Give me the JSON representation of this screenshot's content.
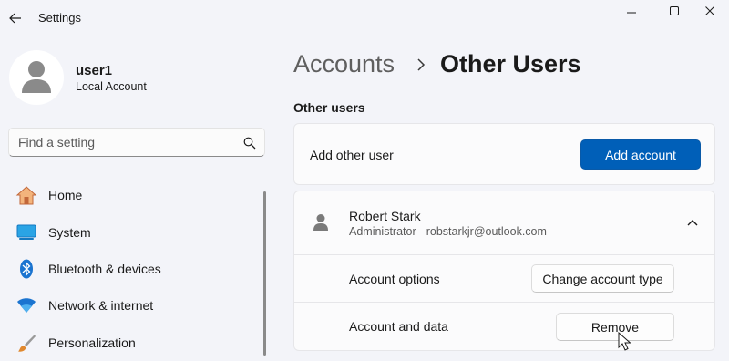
{
  "window": {
    "title": "Settings"
  },
  "user": {
    "name": "user1",
    "type": "Local Account"
  },
  "search": {
    "placeholder": "Find a setting"
  },
  "sidebar": {
    "items": [
      {
        "label": "Home",
        "icon": "home-icon"
      },
      {
        "label": "System",
        "icon": "system-icon"
      },
      {
        "label": "Bluetooth & devices",
        "icon": "bluetooth-icon"
      },
      {
        "label": "Network & internet",
        "icon": "wifi-icon"
      },
      {
        "label": "Personalization",
        "icon": "brush-icon"
      }
    ]
  },
  "breadcrumb": {
    "parent": "Accounts",
    "current": "Other Users"
  },
  "main": {
    "section_title": "Other users",
    "add_user_label": "Add other user",
    "add_account_button": "Add account",
    "account": {
      "name": "Robert Stark",
      "subtitle": "Administrator - robstarkjr@outlook.com",
      "options_label": "Account options",
      "change_type_button": "Change account type",
      "data_label": "Account and data",
      "remove_button": "Remove"
    }
  },
  "colors": {
    "accent": "#005fb8",
    "background": "#f3f4f9",
    "card": "#fbfbfc"
  }
}
